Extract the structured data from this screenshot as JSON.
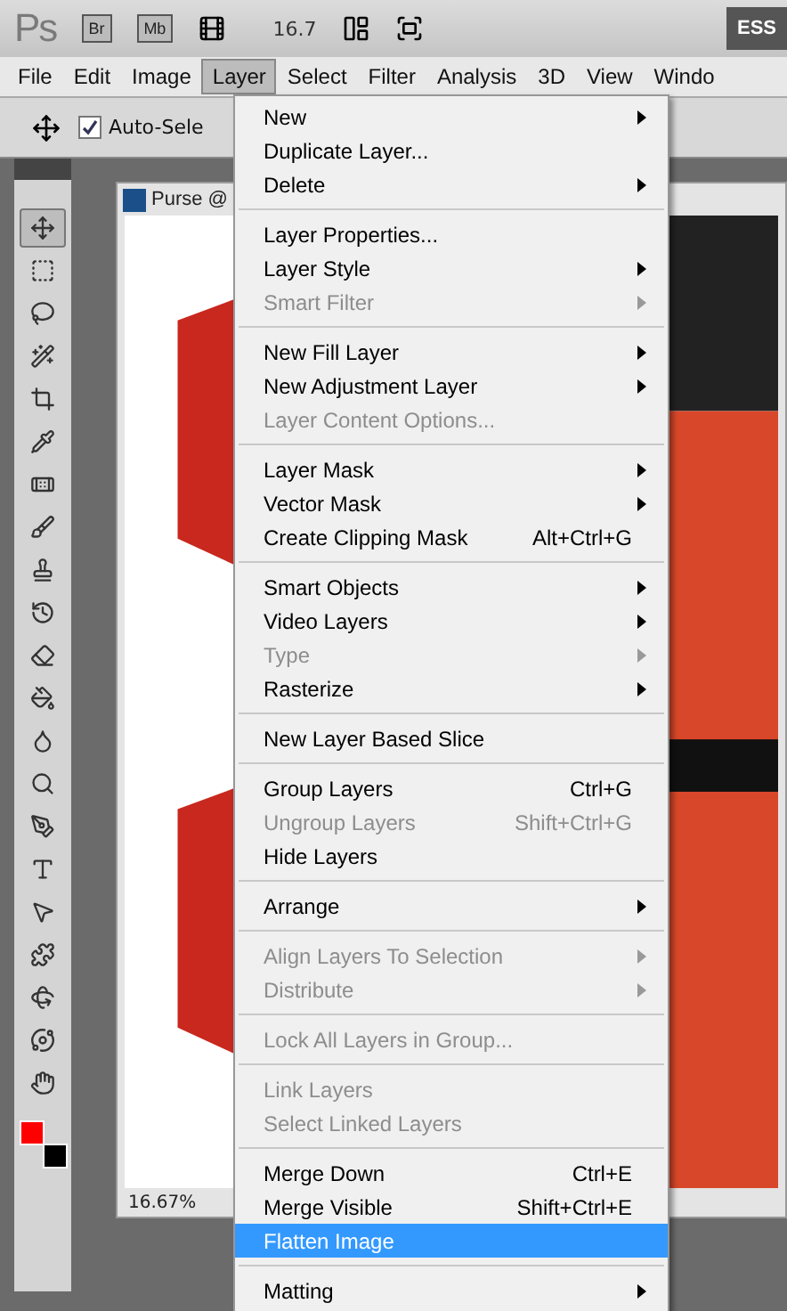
{
  "app_bar": {
    "logo": "Ps",
    "buttons": [
      {
        "label": "Br"
      },
      {
        "label": "Mb"
      }
    ],
    "zoom": "16.7",
    "workspace": "ESS"
  },
  "menubar": [
    {
      "label": "File",
      "selected": false
    },
    {
      "label": "Edit",
      "selected": false
    },
    {
      "label": "Image",
      "selected": false
    },
    {
      "label": "Layer",
      "selected": true
    },
    {
      "label": "Select",
      "selected": false
    },
    {
      "label": "Filter",
      "selected": false
    },
    {
      "label": "Analysis",
      "selected": false
    },
    {
      "label": "3D",
      "selected": false
    },
    {
      "label": "View",
      "selected": false
    },
    {
      "label": "Windo",
      "selected": false
    }
  ],
  "options_bar": {
    "auto_select": {
      "label": "Auto-Sele",
      "checked": true
    }
  },
  "tools": [
    {
      "selected": true
    },
    {
      "selected": false
    },
    {
      "selected": false
    },
    {
      "selected": false
    },
    {
      "selected": false
    },
    {
      "selected": false
    },
    {
      "selected": false
    },
    {
      "selected": false
    },
    {
      "selected": false
    },
    {
      "selected": false
    },
    {
      "selected": false
    },
    {
      "selected": false
    },
    {
      "selected": false
    },
    {
      "selected": false
    },
    {
      "selected": false
    },
    {
      "selected": false
    },
    {
      "selected": false
    },
    {
      "selected": false
    },
    {
      "selected": false
    },
    {
      "selected": false
    },
    {
      "selected": false
    }
  ],
  "document": {
    "title": "Purse @",
    "zoom": "16.67%"
  },
  "layer_menu": [
    [
      {
        "label": "New",
        "submenu": true,
        "disabled": false,
        "selected": false
      },
      {
        "label": "Duplicate Layer...",
        "submenu": false,
        "disabled": false,
        "selected": false
      },
      {
        "label": "Delete",
        "submenu": true,
        "disabled": false,
        "selected": false
      }
    ],
    [
      {
        "label": "Layer Properties...",
        "submenu": false,
        "disabled": false,
        "selected": false
      },
      {
        "label": "Layer Style",
        "submenu": true,
        "disabled": false,
        "selected": false
      },
      {
        "label": "Smart Filter",
        "submenu": true,
        "disabled": true,
        "selected": false
      }
    ],
    [
      {
        "label": "New Fill Layer",
        "submenu": true,
        "disabled": false,
        "selected": false
      },
      {
        "label": "New Adjustment Layer",
        "submenu": true,
        "disabled": false,
        "selected": false
      },
      {
        "label": "Layer Content Options...",
        "submenu": false,
        "disabled": true,
        "selected": false
      }
    ],
    [
      {
        "label": "Layer Mask",
        "submenu": true,
        "disabled": false,
        "selected": false
      },
      {
        "label": "Vector Mask",
        "submenu": true,
        "disabled": false,
        "selected": false
      },
      {
        "label": "Create Clipping Mask",
        "shortcut": "Alt+Ctrl+G",
        "submenu": false,
        "disabled": false,
        "selected": false
      }
    ],
    [
      {
        "label": "Smart Objects",
        "submenu": true,
        "disabled": false,
        "selected": false
      },
      {
        "label": "Video Layers",
        "submenu": true,
        "disabled": false,
        "selected": false
      },
      {
        "label": "Type",
        "submenu": true,
        "disabled": true,
        "selected": false
      },
      {
        "label": "Rasterize",
        "submenu": true,
        "disabled": false,
        "selected": false
      }
    ],
    [
      {
        "label": "New Layer Based Slice",
        "submenu": false,
        "disabled": false,
        "selected": false
      }
    ],
    [
      {
        "label": "Group Layers",
        "shortcut": "Ctrl+G",
        "submenu": false,
        "disabled": false,
        "selected": false
      },
      {
        "label": "Ungroup Layers",
        "shortcut": "Shift+Ctrl+G",
        "submenu": false,
        "disabled": true,
        "selected": false
      },
      {
        "label": "Hide Layers",
        "submenu": false,
        "disabled": false,
        "selected": false
      }
    ],
    [
      {
        "label": "Arrange",
        "submenu": true,
        "disabled": false,
        "selected": false
      }
    ],
    [
      {
        "label": "Align Layers To Selection",
        "submenu": true,
        "disabled": true,
        "selected": false
      },
      {
        "label": "Distribute",
        "submenu": true,
        "disabled": true,
        "selected": false
      }
    ],
    [
      {
        "label": "Lock All Layers in Group...",
        "submenu": false,
        "disabled": true,
        "selected": false
      }
    ],
    [
      {
        "label": "Link Layers",
        "submenu": false,
        "disabled": true,
        "selected": false
      },
      {
        "label": "Select Linked Layers",
        "submenu": false,
        "disabled": true,
        "selected": false
      }
    ],
    [
      {
        "label": "Merge Down",
        "shortcut": "Ctrl+E",
        "submenu": false,
        "disabled": false,
        "selected": false
      },
      {
        "label": "Merge Visible",
        "shortcut": "Shift+Ctrl+E",
        "submenu": false,
        "disabled": false,
        "selected": false
      },
      {
        "label": "Flatten Image",
        "submenu": false,
        "disabled": false,
        "selected": true
      }
    ],
    [
      {
        "label": "Matting",
        "submenu": true,
        "disabled": false,
        "selected": false
      }
    ]
  ]
}
